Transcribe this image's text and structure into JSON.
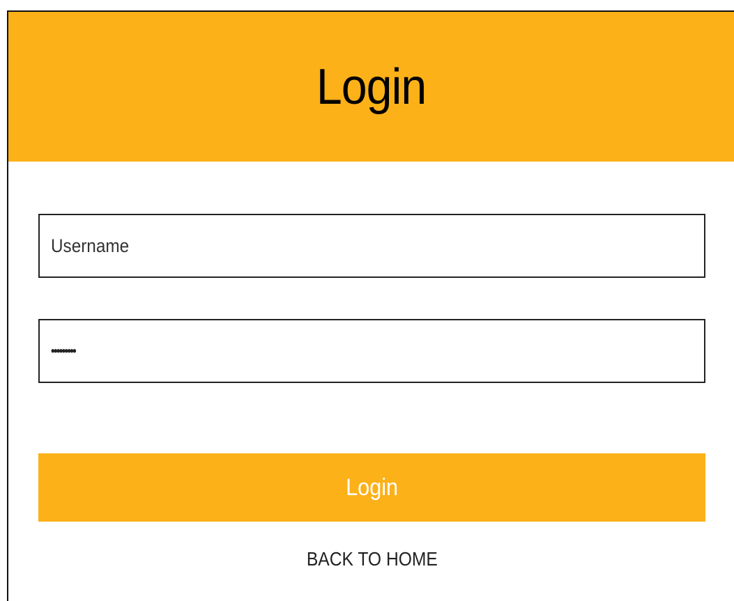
{
  "colors": {
    "accent": "#FCB118",
    "border": "#222222",
    "background": "#FFFFFF"
  },
  "header": {
    "title": "Login"
  },
  "form": {
    "username": {
      "value": "",
      "placeholder": "Username"
    },
    "password": {
      "value": "•••••••••"
    },
    "submit_label": "Login",
    "back_link_label": "BACK TO HOME"
  }
}
